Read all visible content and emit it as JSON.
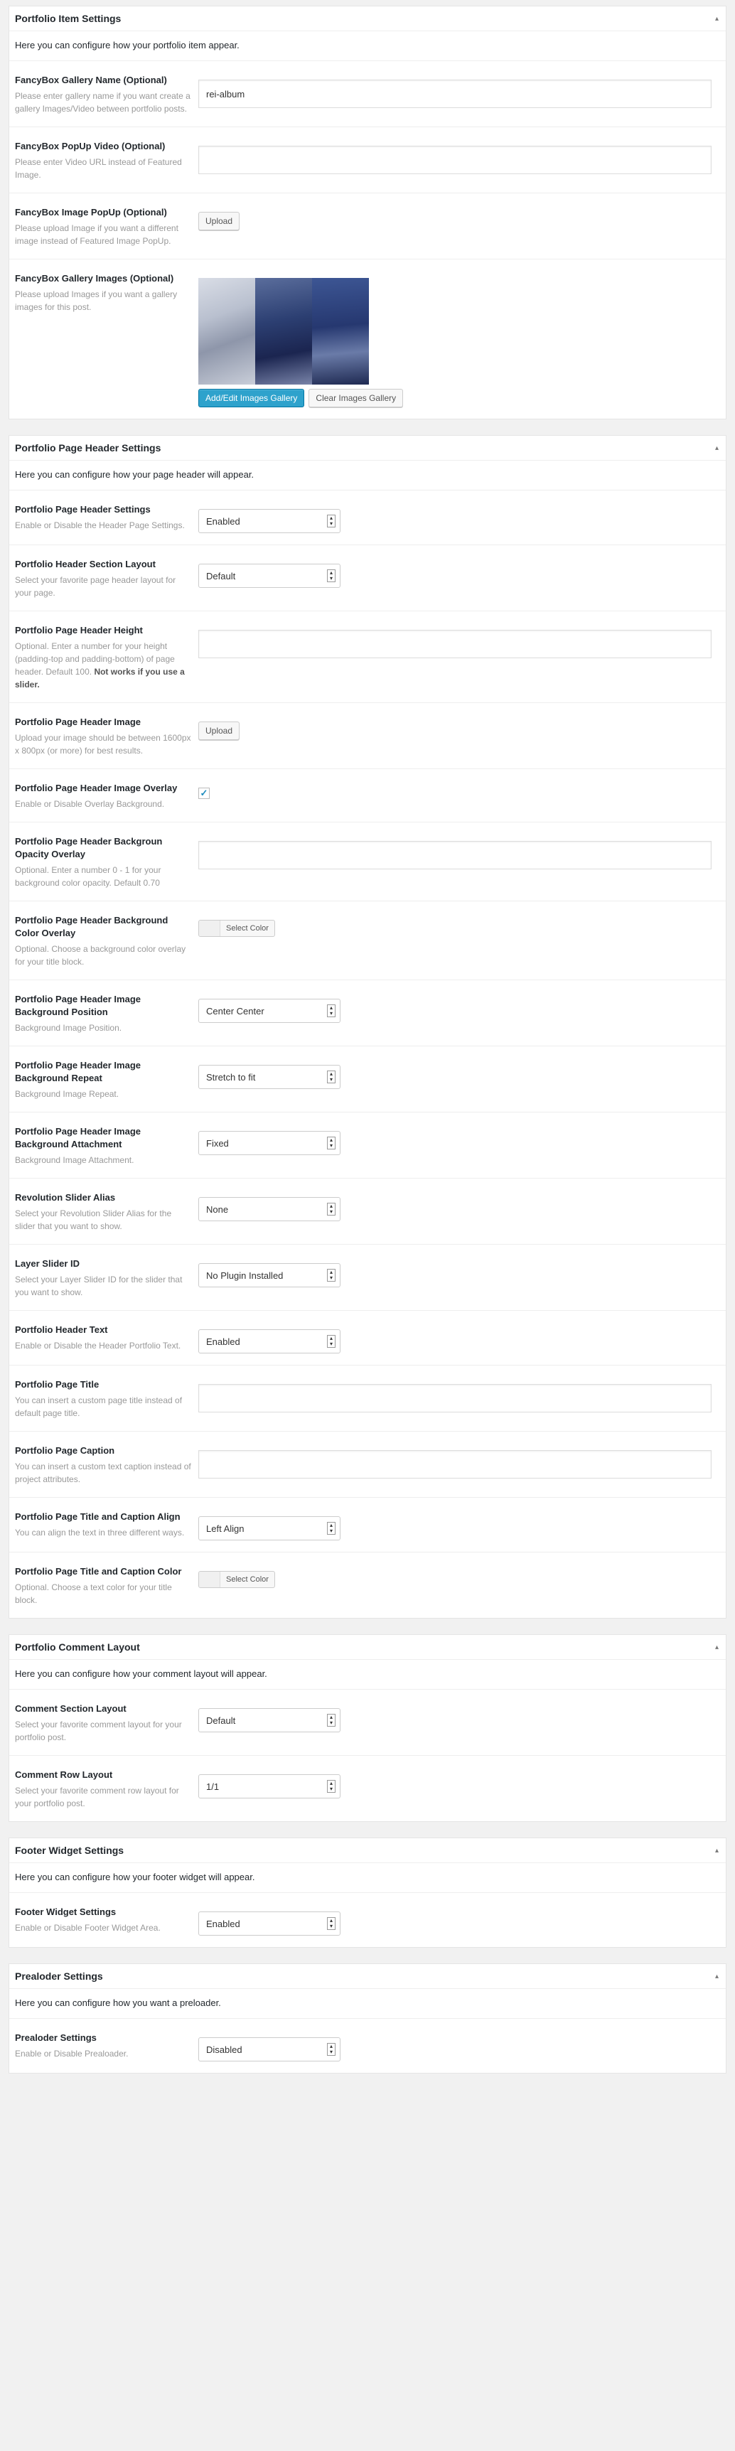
{
  "boxes": [
    {
      "title": "Portfolio Item Settings",
      "intro": "Here you can configure how your portfolio item appear.",
      "rows": [
        {
          "label": "FancyBox Gallery Name (Optional)",
          "desc": "Please enter gallery name if you want create a gallery Images/Video between portfolio posts.",
          "control": "text",
          "value": "rei-album"
        },
        {
          "label": "FancyBox PopUp Video (Optional)",
          "desc": "Please enter Video URL instead of Featured Image.",
          "control": "text",
          "value": ""
        },
        {
          "label": "FancyBox Image PopUp (Optional)",
          "desc": "Please upload Image if you want a different image instead of Featured Image PopUp.",
          "control": "upload",
          "button": "Upload"
        },
        {
          "label": "FancyBox Gallery Images (Optional)",
          "desc": "Please upload Images if you want a gallery images for this post.",
          "control": "gallery",
          "primary": "Add/Edit Images Gallery",
          "secondary": "Clear Images Gallery"
        }
      ]
    },
    {
      "title": "Portfolio Page Header Settings",
      "intro": "Here you can configure how your page header will appear.",
      "rows": [
        {
          "label": "Portfolio Page Header Settings",
          "desc": "Enable or Disable the Header Page Settings.",
          "control": "select",
          "value": "Enabled"
        },
        {
          "label": "Portfolio Header Section Layout",
          "desc": "Select your favorite page header layout for your page.",
          "control": "select",
          "value": "Default"
        },
        {
          "label": "Portfolio Page Header Height",
          "desc": "Optional. Enter a number for your height (padding-top and padding-bottom) of page header. Default 100.",
          "desc_bold": "Not works if you use a slider.",
          "control": "text",
          "value": ""
        },
        {
          "label": "Portfolio Page Header Image",
          "desc": "Upload your image should be between 1600px x 800px (or more) for best results.",
          "control": "upload",
          "button": "Upload"
        },
        {
          "label": "Portfolio Page Header Image Overlay",
          "desc": "Enable or Disable Overlay Background.",
          "control": "checkbox",
          "checked": "✓"
        },
        {
          "label": "Portfolio Page Header Backgroun Opacity Overlay",
          "desc": "Optional. Enter a number 0 - 1 for your background color opacity. Default 0.70",
          "control": "text",
          "value": ""
        },
        {
          "label": "Portfolio Page Header Background Color Overlay",
          "desc": "Optional. Choose a background color overlay for your title block.",
          "control": "color",
          "button": "Select Color"
        },
        {
          "label": "Portfolio Page Header Image Background Position",
          "desc": "Background Image Position.",
          "control": "select",
          "value": "Center Center"
        },
        {
          "label": "Portfolio Page Header Image Background Repeat",
          "desc": "Background Image Repeat.",
          "control": "select",
          "value": "Stretch to fit"
        },
        {
          "label": "Portfolio Page Header Image Background Attachment",
          "desc": "Background Image Attachment.",
          "control": "select",
          "value": "Fixed"
        },
        {
          "label": "Revolution Slider Alias",
          "desc": "Select your Revolution Slider Alias for the slider that you want to show.",
          "control": "select",
          "value": "None"
        },
        {
          "label": "Layer Slider ID",
          "desc": "Select your Layer Slider ID for the slider that you want to show.",
          "control": "select",
          "value": "No Plugin Installed"
        },
        {
          "label": "Portfolio Header Text",
          "desc": "Enable or Disable the Header Portfolio Text.",
          "control": "select",
          "value": "Enabled"
        },
        {
          "label": "Portfolio Page Title",
          "desc": "You can insert a custom page title instead of default page title.",
          "control": "text",
          "value": ""
        },
        {
          "label": "Portfolio Page Caption",
          "desc": "You can insert a custom text caption instead of project attributes.",
          "control": "text",
          "value": ""
        },
        {
          "label": "Portfolio Page Title and Caption Align",
          "desc": "You can align the text in three different ways.",
          "control": "select",
          "value": "Left Align"
        },
        {
          "label": "Portfolio Page Title and Caption Color",
          "desc": "Optional. Choose a text color for your title block.",
          "control": "color",
          "button": "Select Color"
        }
      ]
    },
    {
      "title": "Portfolio Comment Layout",
      "intro": "Here you can configure how your comment layout will appear.",
      "rows": [
        {
          "label": "Comment Section Layout",
          "desc": "Select your favorite comment layout for your portfolio post.",
          "control": "select",
          "value": "Default"
        },
        {
          "label": "Comment Row Layout",
          "desc": "Select your favorite comment row layout for your portfolio post.",
          "control": "select",
          "value": "1/1"
        }
      ]
    },
    {
      "title": "Footer Widget Settings",
      "intro": "Here you can configure how your footer widget will appear.",
      "rows": [
        {
          "label": "Footer Widget Settings",
          "desc": "Enable or Disable Footer Widget Area.",
          "control": "select",
          "value": "Enabled"
        }
      ]
    },
    {
      "title": "Prealoder Settings",
      "intro": "Here you can configure how you want a preloader.",
      "rows": [
        {
          "label": "Prealoder Settings",
          "desc": "Enable or Disable Prealoader.",
          "control": "select",
          "value": "Disabled"
        }
      ]
    }
  ],
  "toggle_icon": "▴",
  "icons": {
    "toggle": "caret-up-icon",
    "select_arrow": "select-arrows-icon"
  },
  "colors": {
    "primary_button": "#2ea2cc",
    "checkbox": "#1e8cbe"
  },
  "gallery_thumbs": [
    "sketch-portrait",
    "blue-hair-girl",
    "blue-hair-girl-closeup"
  ]
}
